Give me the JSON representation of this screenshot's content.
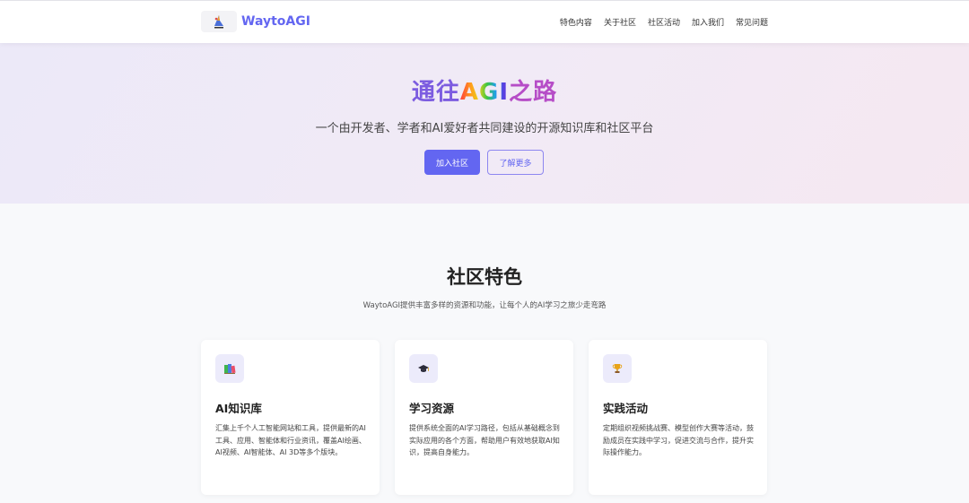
{
  "header": {
    "brand_name": "WaytoAGI",
    "nav": [
      "特色内容",
      "关于社区",
      "社区活动",
      "加入我们",
      "常见问题"
    ]
  },
  "hero": {
    "title_a": "通往",
    "title_b": "AGI",
    "title_c": "之路",
    "subtitle": "一个由开发者、学者和AI爱好者共同建设的开源知识库和社区平台",
    "primary_button": "加入社区",
    "secondary_button": "了解更多"
  },
  "features": {
    "title": "社区特色",
    "description": "WaytoAGI提供丰富多样的资源和功能，让每个人的AI学习之旅少走弯路",
    "cards": [
      {
        "icon": "books-icon",
        "title": "AI知识库",
        "text": "汇集上千个人工智能网站和工具，提供最新的AI工具、应用、智能体和行业资讯，覆盖AI绘画、AI视频、AI智能体、AI 3D等多个版块。"
      },
      {
        "icon": "graduation-cap-icon",
        "title": "学习资源",
        "text": "提供系统全面的AI学习路径，包括从基础概念到实际应用的各个方面，帮助用户有效地获取AI知识，提高自身能力。"
      },
      {
        "icon": "trophy-icon",
        "title": "实践活动",
        "text": "定期组织视频挑战赛、模型创作大赛等活动，鼓励成员在实践中学习，促进交流与合作，提升实际操作能力。"
      }
    ]
  },
  "colors": {
    "accent": "#6366f1",
    "hero_bg_start": "#ece9f8",
    "hero_bg_end": "#f5e8f1"
  }
}
